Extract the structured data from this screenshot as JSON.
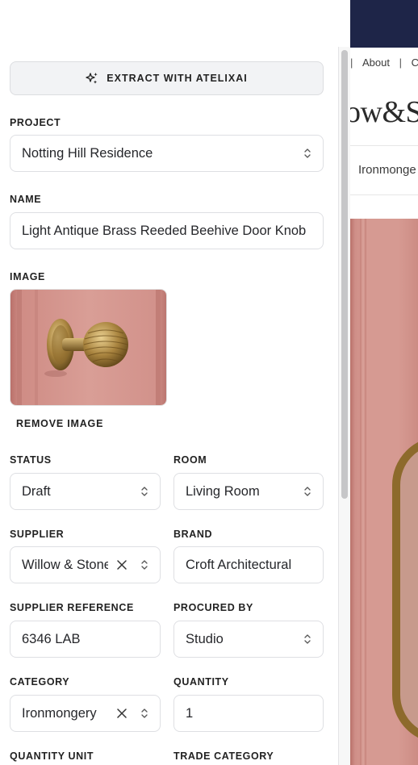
{
  "site": {
    "nav_items": [
      "About",
      "C"
    ],
    "logo_text": "ow&St",
    "breadcrumb": "Ironmonge"
  },
  "form": {
    "extract_button_label": "EXTRACT WITH ATELIXAI",
    "project": {
      "label": "PROJECT",
      "value": "Notting Hill Residence"
    },
    "name": {
      "label": "NAME",
      "value": "Light Antique Brass Reeded Beehive Door Knob"
    },
    "image": {
      "label": "IMAGE",
      "remove_label": "REMOVE IMAGE"
    },
    "status": {
      "label": "STATUS",
      "value": "Draft"
    },
    "room": {
      "label": "ROOM",
      "value": "Living Room"
    },
    "supplier": {
      "label": "SUPPLIER",
      "value": "Willow & Stone"
    },
    "brand": {
      "label": "BRAND",
      "value": "Croft Architectural"
    },
    "supplier_reference": {
      "label": "SUPPLIER REFERENCE",
      "value": "6346 LAB"
    },
    "procured_by": {
      "label": "PROCURED BY",
      "value": "Studio"
    },
    "category": {
      "label": "CATEGORY",
      "value": "Ironmongery"
    },
    "quantity": {
      "label": "QUANTITY",
      "value": "1"
    },
    "quantity_unit": {
      "label": "QUANTITY UNIT"
    },
    "trade_category": {
      "label": "TRADE CATEGORY"
    }
  },
  "colors": {
    "site_topbar": "#1e2548",
    "door_pink": "#d69a92",
    "brass": "#8d6a2c",
    "field_border": "#dedfe3",
    "button_bg": "#f2f3f5"
  }
}
